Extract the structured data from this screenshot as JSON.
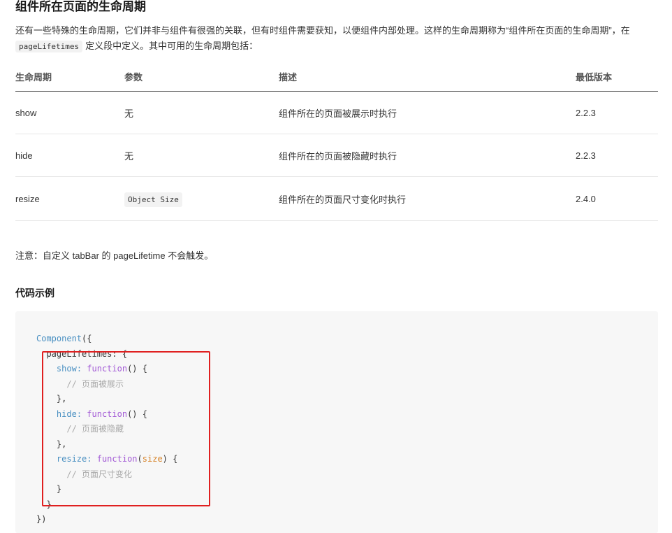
{
  "section": {
    "title": "组件所在页面的生命周期",
    "intro_line1": "还有一些特殊的生命周期，它们并非与组件有很强的关联，但有时组件需要获知，以便组件内部处理。这样的生命周期称为“组件所在页面的生命周期”，在",
    "intro_code": "pageLifetimes",
    "intro_line2_rest": "定义段中定义。其中可用的生命周期包括："
  },
  "table": {
    "headers": [
      "生命周期",
      "参数",
      "描述",
      "最低版本"
    ],
    "rows": [
      {
        "name": "show",
        "param": "无",
        "param_is_code": false,
        "desc": "组件所在的页面被展示时执行",
        "version": "2.2.3"
      },
      {
        "name": "hide",
        "param": "无",
        "param_is_code": false,
        "desc": "组件所在的页面被隐藏时执行",
        "version": "2.2.3"
      },
      {
        "name": "resize",
        "param": "Object Size",
        "param_is_code": true,
        "desc": "组件所在的页面尺寸变化时执行",
        "version": "2.4.0"
      }
    ]
  },
  "note": "注意：自定义 tabBar 的 pageLifetime 不会触发。",
  "example": {
    "title": "代码示例",
    "code": {
      "l1_fn": "Component",
      "l1_rest": "({",
      "l2": "pageLifetimes: {",
      "show_key": "show",
      "function_kw": "function",
      "show_rest": "() {",
      "show_comment": "// 页面被展示",
      "close_brace_comma": "},",
      "hide_key": "hide",
      "hide_rest": "() {",
      "hide_comment": "// 页面被隐藏",
      "resize_key": "resize",
      "resize_param": "size",
      "resize_comment": "// 页面尺寸变化",
      "close_brace": "}",
      "end": "})",
      "colon": ":",
      "open_paren": "(",
      "close_paren_brace": ") {"
    }
  },
  "colors": {
    "highlight_border": "#e02020",
    "version_link": "#576b95",
    "code_background": "#f7f7f7"
  }
}
